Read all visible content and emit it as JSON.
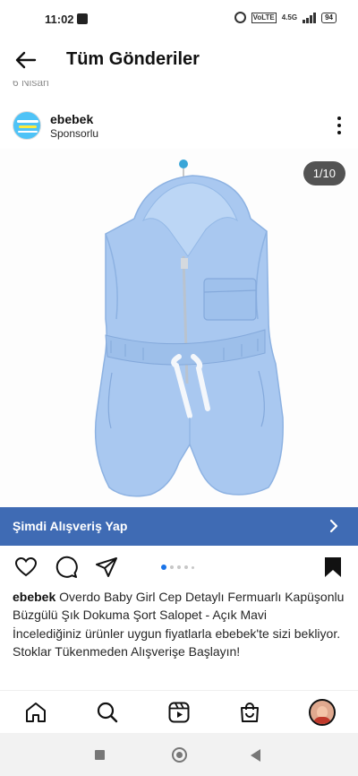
{
  "status_bar": {
    "time": "11:02",
    "network": "4.5G",
    "volte": "VoLTE",
    "battery": "94"
  },
  "header": {
    "title": "Tüm Gönderiler",
    "back_icon": "arrow-left-icon"
  },
  "previous_post": {
    "date": "6 Nisan"
  },
  "post": {
    "account_name": "ebebek",
    "sponsored_label": "Sponsorlu",
    "media_counter": "1/10",
    "media_alt": "Açık mavi kapüşonlu fermuarlı bebek şort salopet",
    "carousel_count": 5,
    "carousel_active": 1,
    "cta_label": "Şimdi Alışveriş Yap",
    "caption_account": "ebebek",
    "caption_text": " Overdo Baby Girl Cep Detaylı Fermuarlı Kapüşonlu Büzgülü Şık Dokuma Şort Salopet - Açık Mavi",
    "description": "İncelediğiniz ürünler uygun fiyatlarla ebebek'te sizi bekliyor. Stoklar Tükenmeden Alışverişe Başlayın!"
  },
  "actions": {
    "icons": [
      "heart-icon",
      "comment-icon",
      "share-icon",
      "bookmark-icon"
    ]
  },
  "bottom_nav": {
    "icons": [
      "home-icon",
      "search-icon",
      "reels-icon",
      "shop-icon",
      "profile-avatar"
    ]
  },
  "colors": {
    "cta_background": "#3f6bb4",
    "carousel_active": "#1a73e8",
    "garment": "#a9c8f0"
  }
}
